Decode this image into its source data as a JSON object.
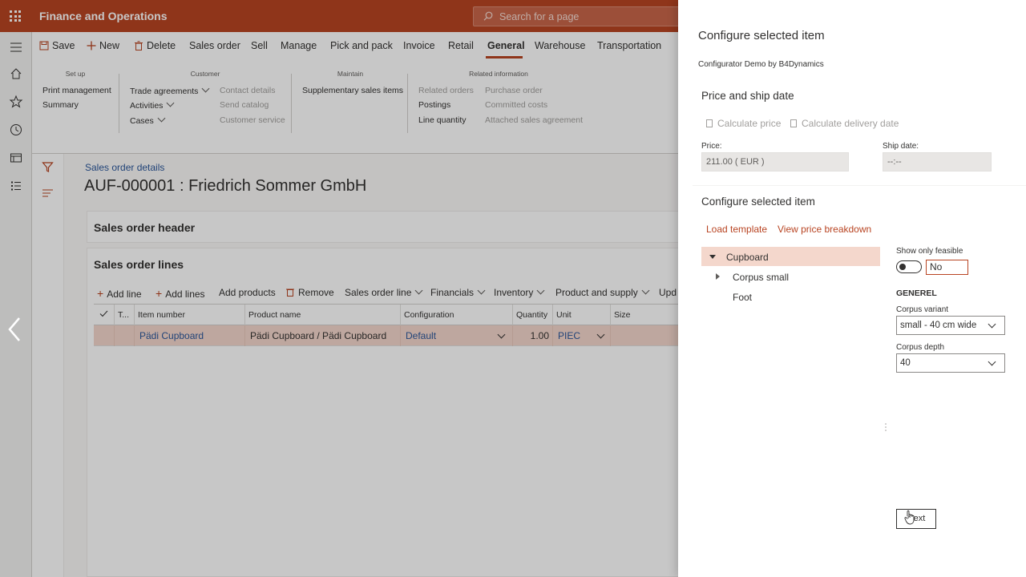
{
  "app": {
    "title": "Finance and Operations",
    "search_placeholder": "Search for a page"
  },
  "actionpane": {
    "tabs": [
      {
        "label": "Save",
        "icon": "save-icon"
      },
      {
        "label": "New",
        "icon": "plus-icon"
      },
      {
        "label": "Delete",
        "icon": "trash-icon"
      },
      {
        "label": "Sales order"
      },
      {
        "label": "Sell"
      },
      {
        "label": "Manage"
      },
      {
        "label": "Pick and pack"
      },
      {
        "label": "Invoice"
      },
      {
        "label": "Retail"
      },
      {
        "label": "General",
        "active": true
      },
      {
        "label": "Warehouse"
      },
      {
        "label": "Transportation"
      }
    ],
    "groups": {
      "setup": {
        "title": "Set up",
        "items": [
          "Print management",
          "Summary"
        ]
      },
      "customer": {
        "title": "Customer",
        "items": [
          "Trade agreements",
          "Activities",
          "Cases"
        ],
        "items_disabled": [
          "Contact details",
          "Send catalog",
          "Customer service"
        ]
      },
      "maintain": {
        "title": "Maintain",
        "items": [
          "Supplementary sales items"
        ]
      },
      "related": {
        "title": "Related information",
        "items": [
          "Related orders",
          "Postings",
          "Line quantity"
        ],
        "items_disabled": [
          "Purchase order",
          "Committed costs",
          "Attached sales agreement"
        ]
      }
    }
  },
  "page": {
    "breadcrumb": "Sales order details",
    "title": "AUF-000001 : Friedrich Sommer GmbH",
    "header_fasttab": "Sales order header",
    "lines_fasttab": "Sales order lines",
    "lines_toolbar": [
      "Add line",
      "Add lines",
      "Add products",
      "Remove",
      "Sales order line",
      "Financials",
      "Inventory",
      "Product and supply",
      "Upd"
    ],
    "grid": {
      "columns": [
        "T...",
        "Item number",
        "Product name",
        "Configuration",
        "Quantity",
        "Unit",
        "Size"
      ],
      "rows": [
        {
          "item_number": "Pädi Cupboard",
          "product_name": "Pädi Cupboard / Pädi Cupboard",
          "configuration": "Default",
          "quantity": "1.00",
          "unit": "PIEC",
          "size": ""
        }
      ]
    }
  },
  "panel": {
    "title": "Configure selected item",
    "subtitle": "Configurator Demo by B4Dynamics",
    "price_section": {
      "title": "Price and ship date",
      "calc_price": "Calculate price",
      "calc_delivery": "Calculate delivery date",
      "price_label": "Price:",
      "price_value": "211.00 ( EUR )",
      "ship_label": "Ship date:",
      "ship_value": "--:--"
    },
    "configure_section": {
      "title": "Configure selected item",
      "load_template": "Load template",
      "view_breakdown": "View price breakdown",
      "tree": [
        "Cupboard",
        "Corpus small",
        "Foot"
      ],
      "show_feasible_label": "Show only feasible",
      "show_feasible_value": "No",
      "group_header": "GENEREL",
      "corpus_variant_label": "Corpus variant",
      "corpus_variant_value": "small - 40 cm wide",
      "corpus_depth_label": "Corpus depth",
      "corpus_depth_value": "40",
      "next_label": "Next"
    }
  }
}
